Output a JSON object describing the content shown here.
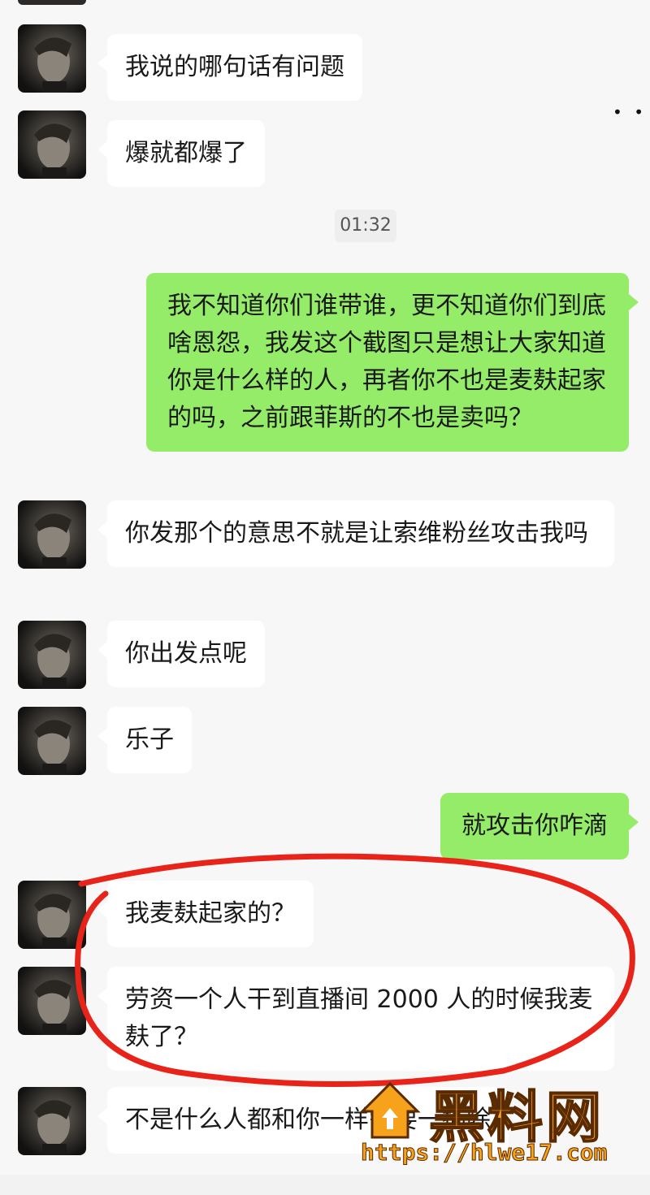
{
  "messages": [
    {
      "side": "left",
      "text": "我说的哪句话有问题"
    },
    {
      "side": "left",
      "text": "爆就都爆了"
    },
    {
      "side": "right",
      "text": "我不知道你们谁带谁，更不知道你们到底啥恩怨，我发这个截图只是想让大家知道你是什么样的人，再者你不也是麦麸起家的吗，之前跟菲斯的不也是卖吗？"
    },
    {
      "side": "left",
      "text": "你发那个的意思不就是让索维粉丝攻击我吗"
    },
    {
      "side": "left",
      "text": "你出发点呢"
    },
    {
      "side": "left",
      "text": "乐子"
    },
    {
      "side": "right",
      "text": "就攻击你咋滴"
    },
    {
      "side": "left",
      "text": "我麦麸起家的？"
    },
    {
      "side": "left",
      "text": "劳资一个人干到直播间 2000 人的时候我麦麸了？"
    },
    {
      "side": "left",
      "text": "不是什么人都和你一样需要一捕除"
    }
  ],
  "timestamp": "01:32",
  "watermark": {
    "title": "黑料网",
    "url": "https://hlwe17.com"
  },
  "colors": {
    "background": "#f7f7f7",
    "sent_bubble": "#95ec69",
    "received_bubble": "#ffffff",
    "highlight": "#e8231a",
    "watermark": "#f7a21b"
  },
  "icons": {
    "avatar": "portrait-avatar-icon",
    "watermark_logo": "house-logo-icon"
  }
}
